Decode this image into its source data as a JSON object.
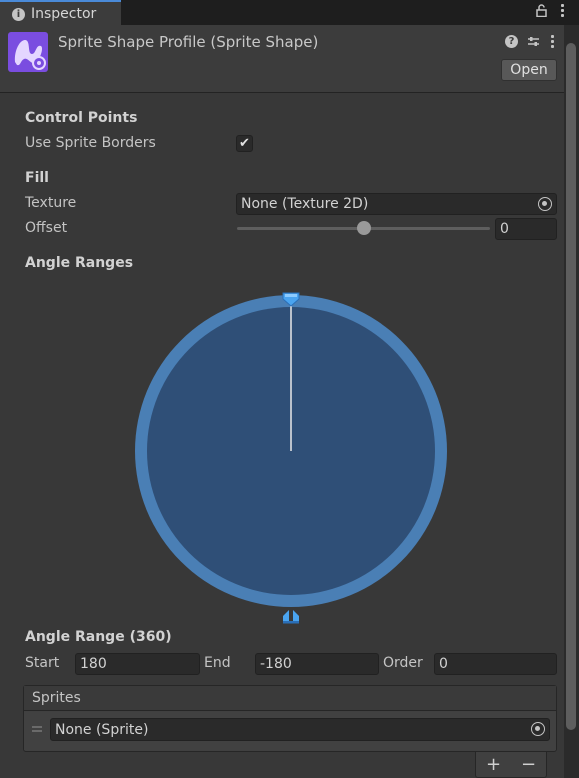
{
  "tab": {
    "title": "Inspector"
  },
  "header": {
    "title": "Sprite Shape Profile (Sprite Shape)",
    "open_label": "Open"
  },
  "control_points": {
    "heading": "Control Points",
    "use_sprite_borders_label": "Use Sprite Borders",
    "use_sprite_borders_checked": true,
    "check_glyph": "✔"
  },
  "fill": {
    "heading": "Fill",
    "texture_label": "Texture",
    "texture_value": "None (Texture 2D)",
    "offset_label": "Offset",
    "offset_value": "0",
    "offset_slider_fraction": 0.5
  },
  "angle_ranges": {
    "heading": "Angle Ranges",
    "circle_color": "#2f4f77",
    "ring_color": "#4a7fb5"
  },
  "angle_range": {
    "heading": "Angle Range (360)",
    "start_label": "Start",
    "start_value": "180",
    "end_label": "End",
    "end_value": "-180",
    "order_label": "Order",
    "order_value": "0"
  },
  "sprites": {
    "heading": "Sprites",
    "items": [
      {
        "value": "None (Sprite)"
      }
    ]
  },
  "list_controls": {
    "add": "+",
    "remove": "−"
  },
  "colors": {
    "accent": "#4a8ad8",
    "panel": "#383838",
    "field": "#2a2a2a"
  }
}
